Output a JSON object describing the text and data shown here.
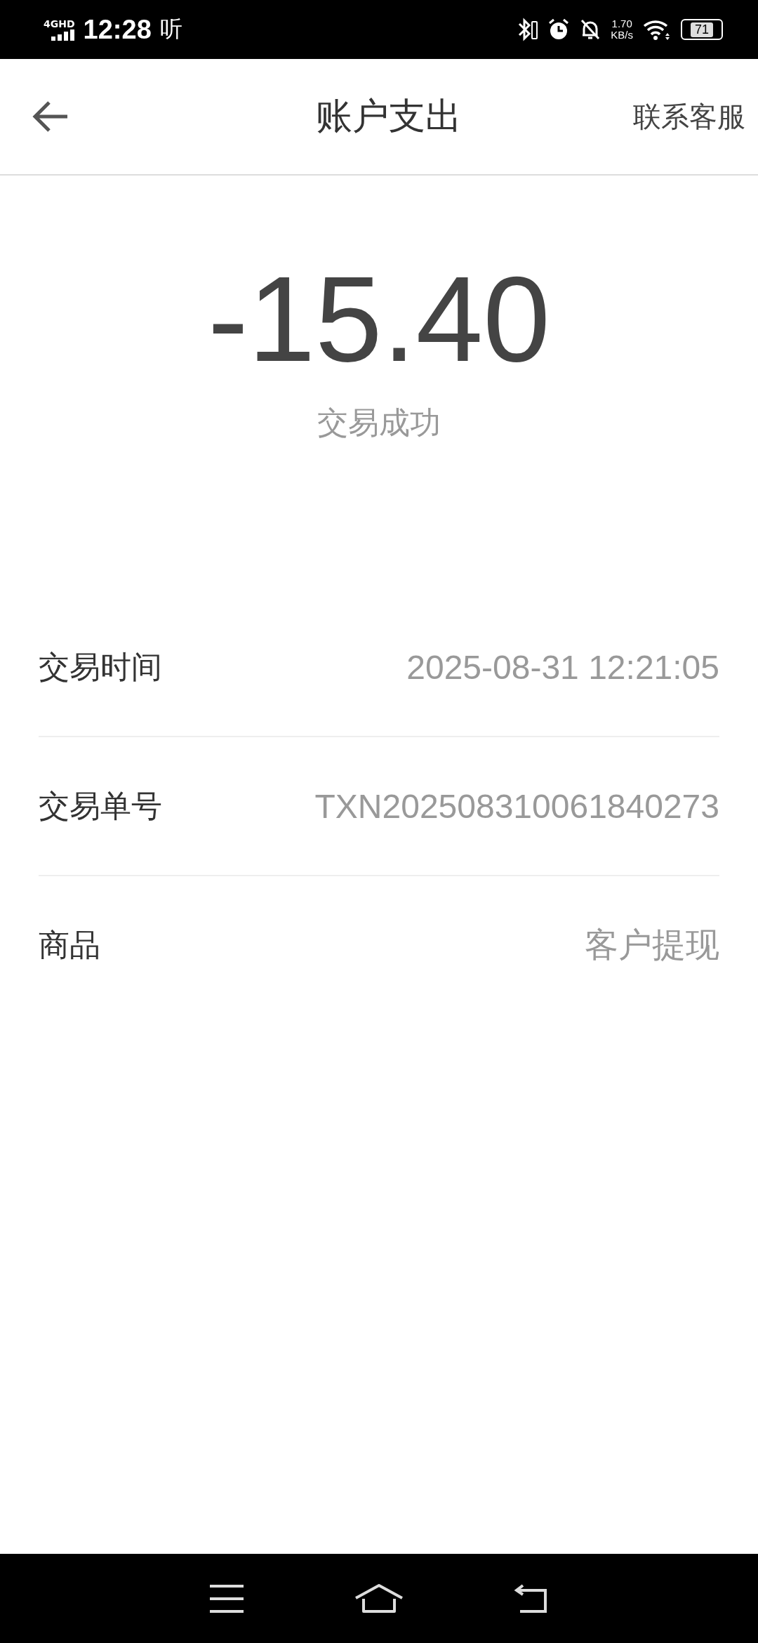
{
  "status_bar": {
    "network": "4GHD",
    "time": "12:28",
    "app_glyph": "听",
    "speed_value": "1.70",
    "speed_unit": "KB/s",
    "battery": "71"
  },
  "header": {
    "title": "账户支出",
    "action": "联系客服"
  },
  "amount": "-15.40",
  "status": "交易成功",
  "details": [
    {
      "label": "交易时间",
      "value": "2025-08-31 12:21:05"
    },
    {
      "label": "交易单号",
      "value": "TXN202508310061840273"
    },
    {
      "label": "商品",
      "value": "客户提现"
    }
  ]
}
